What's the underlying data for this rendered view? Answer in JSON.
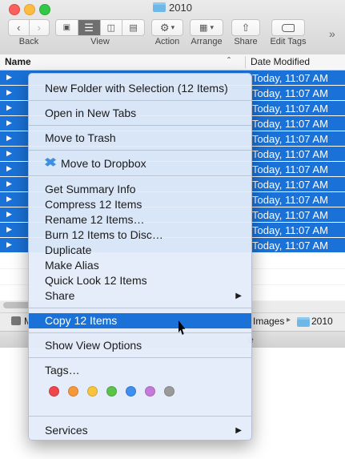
{
  "window": {
    "title": "2010",
    "toolbar": {
      "back_label": "Back",
      "view_label": "View",
      "action_label": "Action",
      "arrange_label": "Arrange",
      "share_label": "Share",
      "edit_tags_label": "Edit Tags",
      "overflow": "»"
    },
    "columns": {
      "name": "Name",
      "date_modified": "Date Modified"
    },
    "rows": [
      {
        "date": "Today, 11:07 AM"
      },
      {
        "date": "Today, 11:07 AM"
      },
      {
        "date": "Today, 11:07 AM"
      },
      {
        "date": "Today, 11:07 AM"
      },
      {
        "date": "Today, 11:07 AM"
      },
      {
        "date": "Today, 11:07 AM"
      },
      {
        "date": "Today, 11:07 AM"
      },
      {
        "date": "Today, 11:07 AM"
      },
      {
        "date": "Today, 11:07 AM"
      },
      {
        "date": "Today, 11:07 AM"
      },
      {
        "date": "Today, 11:07 AM"
      },
      {
        "date": "Today, 11:07 AM"
      }
    ],
    "path_bar": {
      "first": "M",
      "images": "Images",
      "current": "2010"
    },
    "status": "e"
  },
  "context_menu": {
    "items": {
      "new_folder": "New Folder with Selection (12 Items)",
      "open_tabs": "Open in New Tabs",
      "trash": "Move to Trash",
      "dropbox": "Move to Dropbox",
      "summary": "Get Summary Info",
      "compress": "Compress 12 Items",
      "rename": "Rename 12 Items…",
      "burn": "Burn 12 Items to Disc…",
      "duplicate": "Duplicate",
      "alias": "Make Alias",
      "quicklook": "Quick Look 12 Items",
      "share": "Share",
      "copy": "Copy 12 Items",
      "view_options": "Show View Options",
      "tags": "Tags…",
      "services": "Services"
    },
    "tag_colors": [
      "#f0454b",
      "#f6973a",
      "#f7c43b",
      "#5ac34a",
      "#3f8ef0",
      "#c57adb",
      "#9a9a9a"
    ]
  }
}
